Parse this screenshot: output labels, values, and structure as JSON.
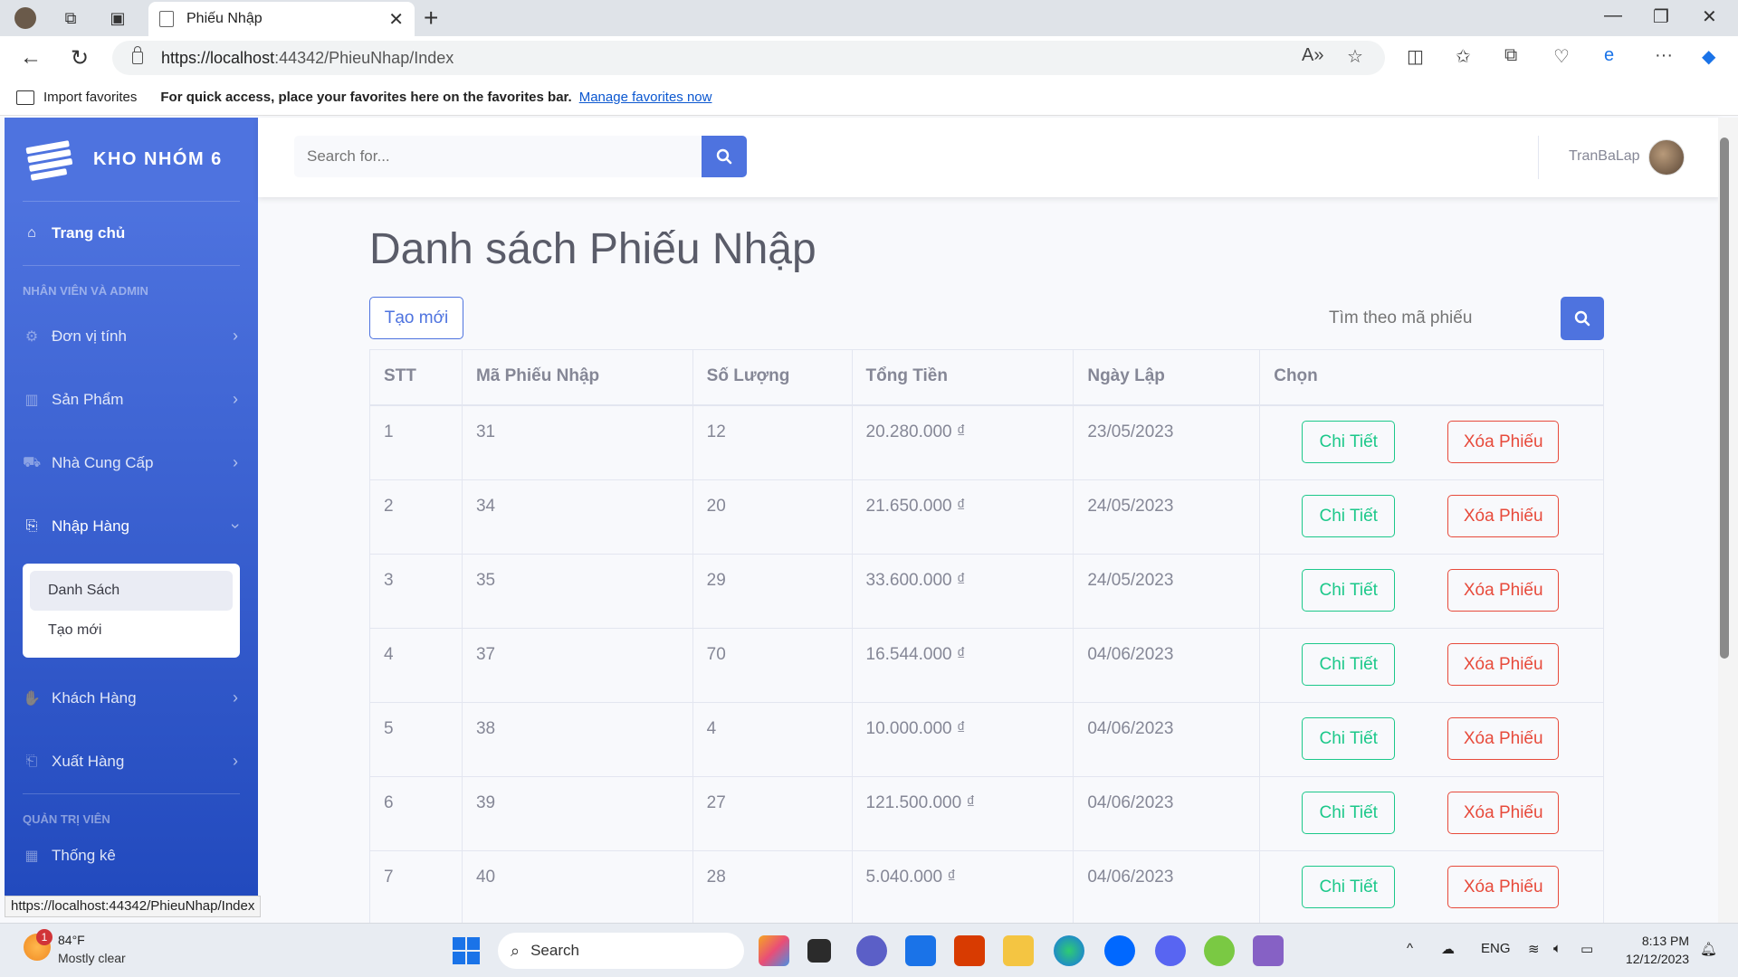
{
  "browser": {
    "tab_title": "Phiếu Nhập",
    "url_host": "https://localhost",
    "url_rest": ":44342/PhieuNhap/Index",
    "favorites_import": "Import favorites",
    "favorites_message": "For quick access, place your favorites here on the favorites bar.",
    "favorites_link": "Manage favorites now",
    "status_url": "https://localhost:44342/PhieuNhap/Index"
  },
  "sidebar": {
    "brand": "KHO NHÓM 6",
    "home": "Trang chủ",
    "heading_staff": "NHÂN VIÊN VÀ ADMIN",
    "items": [
      {
        "label": "Đơn vị tính",
        "icon": "gear-icon"
      },
      {
        "label": "Sản Phẩm",
        "icon": "pallet-icon"
      },
      {
        "label": "Nhà Cung Cấp",
        "icon": "truck-icon"
      },
      {
        "label": "Nhập Hàng",
        "icon": "file-import-icon"
      }
    ],
    "submenu": [
      "Danh Sách",
      "Tạo mới"
    ],
    "items2": [
      {
        "label": "Khách Hàng",
        "icon": "handshake-icon"
      },
      {
        "label": "Xuất Hàng",
        "icon": "file-export-icon"
      }
    ],
    "heading_admin": "QUẢN TRỊ VIÊN",
    "stats": "Thống kê"
  },
  "topbar": {
    "search_placeholder": "Search for...",
    "username": "TranBaLap"
  },
  "main": {
    "title": "Danh sách Phiếu Nhập",
    "create_button": "Tạo mới",
    "find_placeholder": "Tìm theo mã phiếu",
    "columns": [
      "STT",
      "Mã Phiếu Nhập",
      "Số Lượng",
      "Tổng Tiền",
      "Ngày Lập",
      "Chọn"
    ],
    "detail_label": "Chi Tiết",
    "delete_label": "Xóa Phiếu",
    "rows": [
      {
        "stt": "1",
        "ma": "31",
        "sl": "12",
        "tt": "20.280.000 ₫",
        "nl": "23/05/2023"
      },
      {
        "stt": "2",
        "ma": "34",
        "sl": "20",
        "tt": "21.650.000 ₫",
        "nl": "24/05/2023"
      },
      {
        "stt": "3",
        "ma": "35",
        "sl": "29",
        "tt": "33.600.000 ₫",
        "nl": "24/05/2023"
      },
      {
        "stt": "4",
        "ma": "37",
        "sl": "70",
        "tt": "16.544.000 ₫",
        "nl": "04/06/2023"
      },
      {
        "stt": "5",
        "ma": "38",
        "sl": "4",
        "tt": "10.000.000 ₫",
        "nl": "04/06/2023"
      },
      {
        "stt": "6",
        "ma": "39",
        "sl": "27",
        "tt": "121.500.000 ₫",
        "nl": "04/06/2023"
      },
      {
        "stt": "7",
        "ma": "40",
        "sl": "28",
        "tt": "5.040.000 ₫",
        "nl": "04/06/2023"
      }
    ]
  },
  "taskbar": {
    "weather_temp": "84°F",
    "weather_desc": "Mostly clear",
    "weather_badge": "1",
    "search": "Search",
    "lang": "ENG",
    "time": "8:13 PM",
    "date": "12/12/2023"
  },
  "colors": {
    "primary": "#4e73df",
    "success": "#1cc88a",
    "danger": "#e74a3b",
    "text": "#858796"
  }
}
